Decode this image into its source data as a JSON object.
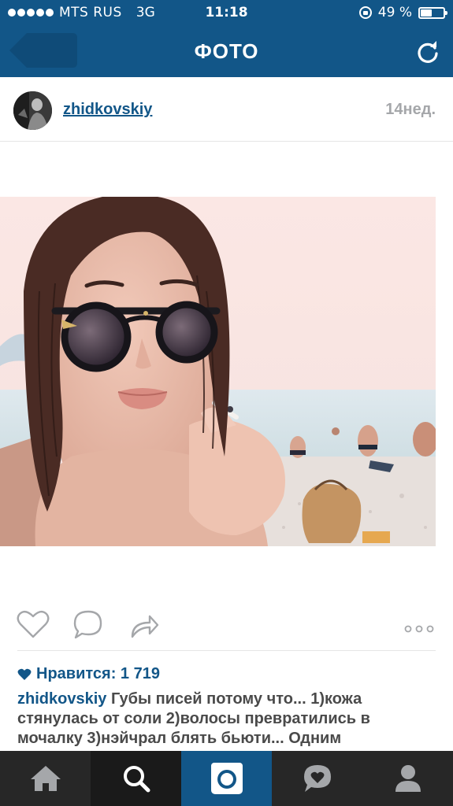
{
  "status_bar": {
    "carrier": "MTS RUS",
    "network": "3G",
    "time": "11:18",
    "battery_text": "49 %",
    "battery_level": 0.49
  },
  "nav": {
    "title": "ФОТО",
    "back_icon": "back-arrow-icon",
    "refresh_icon": "refresh-icon"
  },
  "post": {
    "username": "zhidkovskiy",
    "time_ago": "14нед.",
    "likes_text": "Нравится: 1 719",
    "caption_user": "zhidkovskiy",
    "caption_text": " Губы писей потому что... 1)кожа стянулась от соли 2)волосы превратились в мочалку 3)нэйчрал блять бьюти... Одним"
  },
  "colors": {
    "brand": "#125688",
    "tab_bar": "#272727",
    "icon_gray": "#a5a7aa"
  },
  "tabs": [
    {
      "name": "home-icon"
    },
    {
      "name": "search-icon"
    },
    {
      "name": "camera-icon"
    },
    {
      "name": "activity-icon"
    },
    {
      "name": "profile-icon"
    }
  ]
}
